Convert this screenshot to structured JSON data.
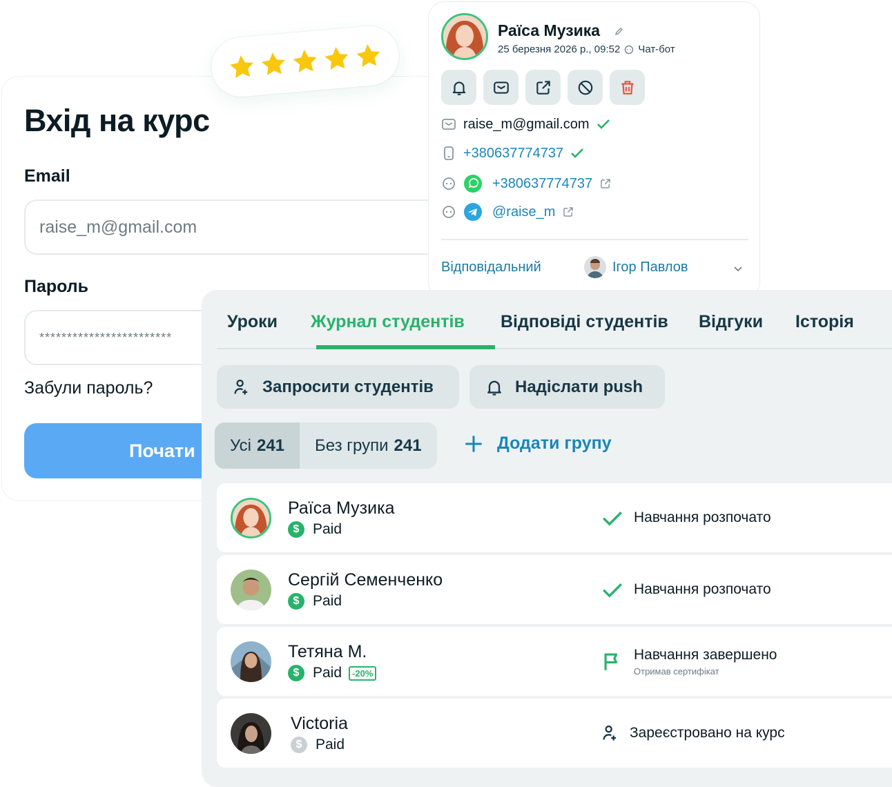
{
  "login": {
    "title": "Вхід на курс",
    "email_label": "Email",
    "email_value": "raise_m@gmail.com",
    "password_label": "Пароль",
    "password_value": "************************",
    "forgot_label": "Забули пароль?",
    "start_label": "Почати"
  },
  "rating": {
    "stars": 5,
    "star_color": "#F9C80E"
  },
  "contact": {
    "name": "Раїса Музика",
    "datetime": "25 березня 2026 р., 09:52",
    "source": "Чат-бот",
    "actions": [
      "bell-icon",
      "envelope-icon",
      "external-link-icon",
      "block-icon",
      "trash-icon"
    ],
    "email": "raise_m@gmail.com",
    "phone": "+380637774737",
    "whatsapp": "+380637774737",
    "telegram": "@raise_m",
    "responsible_label": "Відповідальний",
    "responsible_name": "Ігор Павлов"
  },
  "panel": {
    "tabs": [
      "Уроки",
      "Журнал студентів",
      "Відповіді студентів",
      "Відгуки",
      "Історія"
    ],
    "active_tab": 1,
    "invite_label": "Запросити студентів",
    "push_label": "Надіслати push",
    "filters": [
      {
        "label": "Усі",
        "count": "241"
      },
      {
        "label": "Без групи",
        "count": "241"
      }
    ],
    "add_group_label": "Додати групу",
    "students": [
      {
        "name": "Раїса Музика",
        "paid": "Paid",
        "discount": "",
        "status": "Навчання розпочато",
        "status_sub": "",
        "status_icon": "check-icon"
      },
      {
        "name": "Сергій Семенченко",
        "paid": "Paid",
        "discount": "",
        "status": "Навчання розпочато",
        "status_sub": "",
        "status_icon": "check-icon"
      },
      {
        "name": "Тетяна М.",
        "paid": "Paid",
        "discount": "-20%",
        "status": "Навчання завершено",
        "status_sub": "Отримав сертифікат",
        "status_icon": "flag-icon"
      },
      {
        "name": "Victoria",
        "paid": "Paid",
        "discount": "",
        "status": "Зареєстровано на курс",
        "status_sub": "",
        "status_icon": "user-add-icon"
      }
    ]
  },
  "colors": {
    "accent_green": "#27B36A",
    "accent_blue": "#1A87B8",
    "primary_button": "#5AA9F5"
  }
}
